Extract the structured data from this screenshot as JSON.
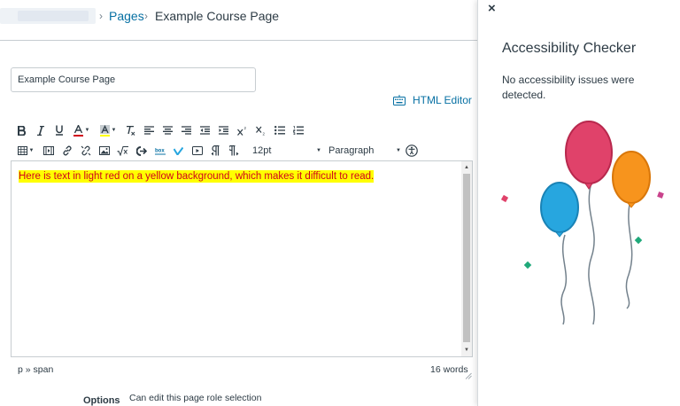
{
  "breadcrumb": {
    "separator": "›",
    "pages_link": "Pages",
    "current": "Example Course Page"
  },
  "title_input": {
    "value": "Example Course Page"
  },
  "html_editor": {
    "label": "HTML Editor"
  },
  "toolbar": {
    "font_size": "12pt",
    "paragraph": "Paragraph"
  },
  "editor": {
    "content": "Here is text in light red on a yellow background, which makes it difficult to read.",
    "text_color": "#d0021b",
    "highlight_color": "#ffff00"
  },
  "status": {
    "path": "p » span",
    "word_count": "16 words"
  },
  "options": {
    "label": "Options",
    "value": "Can edit this page role selection"
  },
  "panel": {
    "close": "×",
    "title": "Accessibility Checker",
    "message": "No accessibility issues were detected."
  },
  "colors": {
    "link": "#0770a3",
    "text": "#2d3b45",
    "balloon_pink": "#e0426a",
    "balloon_orange": "#f7941d",
    "balloon_blue": "#27a6df"
  }
}
